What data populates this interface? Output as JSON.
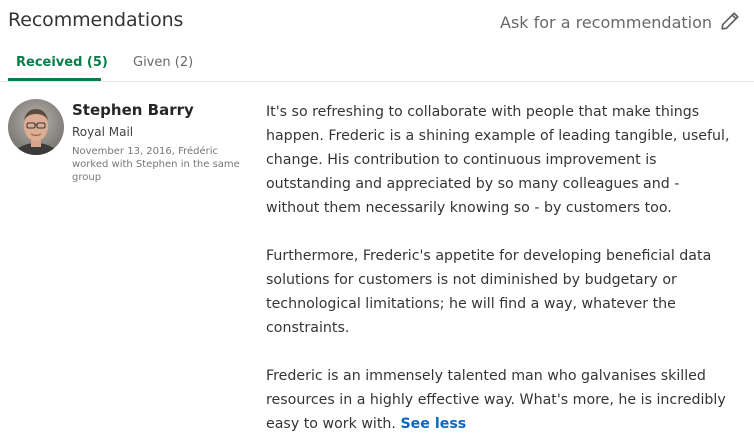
{
  "header": {
    "title": "Recommendations",
    "ask_label": "Ask for a recommendation",
    "edit_icon": "pencil-icon"
  },
  "tabs": [
    {
      "label": "Received (5)",
      "active": true
    },
    {
      "label": "Given (2)",
      "active": false
    }
  ],
  "colors": {
    "accent_green": "#0a7d4a",
    "link_blue": "#0a66c2"
  },
  "recommendation": {
    "name": "Stephen Barry",
    "company": "Royal Mail",
    "context": "November 13, 2016, Frédéric worked with Stephen in the same group",
    "paragraphs": [
      "It's so refreshing to collaborate with people that make things happen. Frederic is a shining example of leading tangible, useful, change. His contribution to continuous improvement is outstanding and appreciated by so many colleagues and - without them necessarily knowing so - by customers too.",
      "Furthermore, Frederic's appetite for developing beneficial data solutions for customers is not diminished by budgetary or technological limitations; he will find a way, whatever the constraints.",
      "Frederic is an immensely talented man who galvanises skilled resources in a highly effective way. What's more, he is incredibly easy to work with."
    ],
    "see_less_label": "See less"
  }
}
